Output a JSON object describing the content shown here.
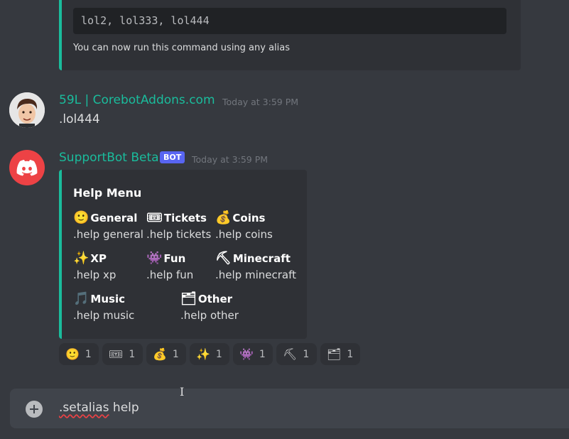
{
  "top_embed": {
    "code": "lol2, lol333, lol444",
    "text": "You can now run this command using any alias",
    "accent": "#1abc9c"
  },
  "user_message": {
    "username": "59L | CorebotAddons.com",
    "timestamp": "Today at 3:59 PM",
    "text": ".lol444"
  },
  "bot_message": {
    "username": "SupportBot Beta",
    "tag": "BOT",
    "timestamp": "Today at 3:59 PM"
  },
  "help_embed": {
    "title": "Help Menu",
    "fields": [
      {
        "emoji": "🙂",
        "name": "General",
        "value": ".help general"
      },
      {
        "emoji": "🎟",
        "name": "Tickets",
        "value": ".help tickets"
      },
      {
        "emoji": "💰",
        "name": "Coins",
        "value": ".help coins"
      },
      {
        "emoji": "✨",
        "name": "XP",
        "value": ".help xp"
      },
      {
        "emoji": "👾",
        "name": "Fun",
        "value": ".help fun"
      },
      {
        "emoji": "⛏",
        "name": "Minecraft",
        "value": ".help minecraft"
      },
      {
        "emoji": "🎵",
        "name": "Music",
        "value": ".help music"
      },
      {
        "emoji": "🗂",
        "name": "Other",
        "value": ".help other"
      }
    ]
  },
  "reactions": [
    {
      "emoji": "🙂",
      "count": "1"
    },
    {
      "emoji": "🎟",
      "count": "1"
    },
    {
      "emoji": "💰",
      "count": "1"
    },
    {
      "emoji": "✨",
      "count": "1"
    },
    {
      "emoji": "👾",
      "count": "1"
    },
    {
      "emoji": "⛏",
      "count": "1"
    },
    {
      "emoji": "🗂",
      "count": "1"
    }
  ],
  "composer": {
    "word1": ".setalias",
    "word2": " help"
  }
}
